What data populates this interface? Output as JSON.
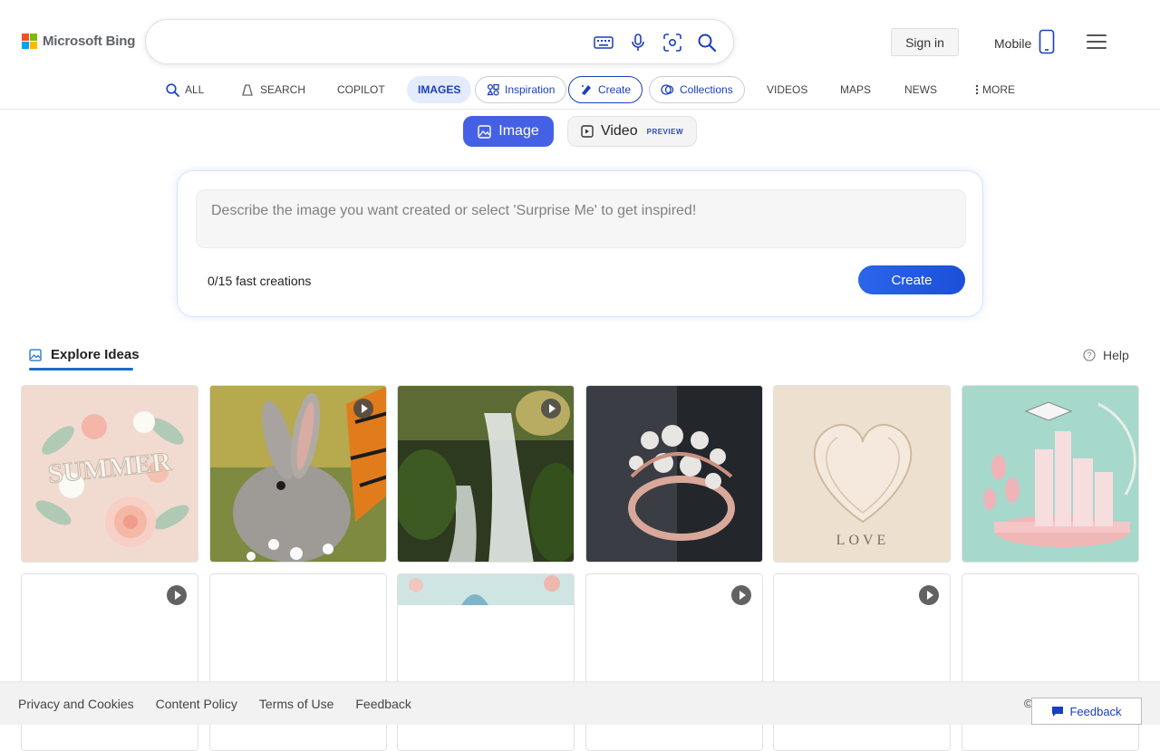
{
  "brand": {
    "name": "Microsoft Bing",
    "logo_colors": [
      "#f25022",
      "#7fba00",
      "#00a4ef",
      "#ffb900"
    ]
  },
  "header": {
    "search": {
      "value": "",
      "placeholder": ""
    },
    "icons": [
      "keyboard-icon",
      "microphone-icon",
      "visual-search-icon",
      "search-icon"
    ],
    "sign_in_label": "Sign in",
    "mobile_label": "Mobile"
  },
  "tabs": [
    {
      "label": "ALL",
      "icon": "search-icon"
    },
    {
      "label": "SEARCH",
      "icon": "copilot-search-icon"
    },
    {
      "label": "COPILOT"
    },
    {
      "label": "IMAGES",
      "active": true
    },
    {
      "label": "Inspiration",
      "icon": "inspiration-icon"
    },
    {
      "label": "Create",
      "icon": "create-icon",
      "selected": true
    },
    {
      "label": "Collections",
      "icon": "collections-icon"
    },
    {
      "label": "VIDEOS"
    },
    {
      "label": "MAPS"
    },
    {
      "label": "NEWS"
    },
    {
      "label": "MORE",
      "icon": "more-vertical-icon"
    }
  ],
  "mode_toggle": {
    "image_label": "Image",
    "video_label": "Video",
    "video_tag": "PREVIEW"
  },
  "create_panel": {
    "prompt_placeholder": "Describe the image you want created or select 'Surprise Me' to get inspired!",
    "fast_creations": "0/15 fast creations",
    "create_button": "Create"
  },
  "explore": {
    "title": "Explore Ideas",
    "help_label": "Help",
    "row1": [
      {
        "subject": "paper-flower-summer",
        "video": false,
        "word": "SUMMER"
      },
      {
        "subject": "rabbit-butterfly",
        "video": true
      },
      {
        "subject": "forest-waterfall",
        "video": true
      },
      {
        "subject": "pearl-ring",
        "video": false
      },
      {
        "subject": "paper-heart-love",
        "video": false,
        "word": "LOVE"
      },
      {
        "subject": "graduation-city",
        "video": false
      }
    ],
    "row2": [
      {
        "video": true
      },
      {
        "video": false
      },
      {
        "video": false,
        "partial_image": true
      },
      {
        "video": true
      },
      {
        "video": true
      },
      {
        "video": false
      }
    ]
  },
  "footer": {
    "links": [
      "Privacy and Cookies",
      "Content Policy",
      "Terms of Use",
      "Feedback"
    ],
    "copyright": "©",
    "feedback_button": "Feedback"
  },
  "colors": {
    "accent": "#1a3fbd",
    "image_mode": "#4461e6",
    "create_button": "#2a66ea"
  }
}
